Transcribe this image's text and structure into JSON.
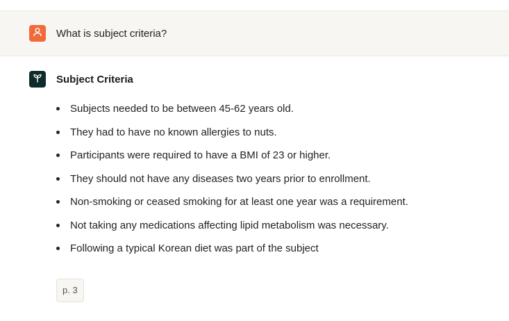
{
  "user_message": {
    "icon": "user-icon",
    "text": "What is subject criteria?",
    "avatar_color": "#f26a3a",
    "row_background": "#f8f6f2"
  },
  "assistant_message": {
    "icon": "sprout-icon",
    "avatar_color": "#0f2b2b",
    "title": "Subject Criteria",
    "bullets": [
      "Subjects needed to be between 45-62 years old.",
      "They had to have no known allergies to nuts.",
      "Participants were required to have a BMI of 23 or higher.",
      "They should not have any diseases two years prior to enrollment.",
      "Non-smoking or ceased smoking for at least one year was a requirement.",
      "Not taking any medications affecting lipid metabolism was necessary.",
      "Following a typical Korean diet was part of the subject"
    ],
    "citation": "p. 3"
  }
}
